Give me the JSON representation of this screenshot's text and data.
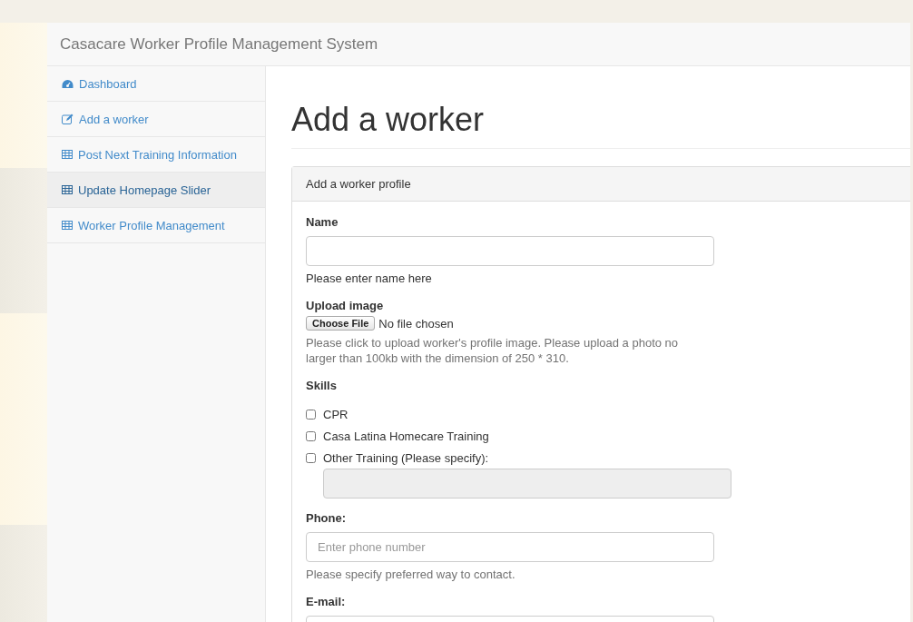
{
  "navbar": {
    "brand": "Casacare Worker Profile Management System"
  },
  "sidebar": {
    "items": [
      {
        "label": "Dashboard",
        "kind": "dashboard",
        "selected": false
      },
      {
        "label": "Add a worker",
        "kind": "edit",
        "selected": false
      },
      {
        "label": "Post Next Training Information",
        "kind": "table",
        "selected": false
      },
      {
        "label": "Update Homepage Slider",
        "kind": "table",
        "selected": true
      },
      {
        "label": "Worker Profile Management",
        "kind": "table",
        "selected": false
      }
    ]
  },
  "page_title": "Add a worker",
  "panel": {
    "heading": "Add a worker profile",
    "fields": [
      {
        "kind": "text",
        "label": "Name",
        "help": "Please enter name here",
        "help_dark": true
      },
      {
        "kind": "file",
        "label": "Upload image",
        "button": "Choose File",
        "status": "No file chosen",
        "help": "Please click to upload worker's profile image. Please upload a photo no larger than 100kb with the dimension of 250 * 310."
      },
      {
        "kind": "checks",
        "label": "Skills",
        "options": [
          {
            "label": "CPR",
            "checked": false
          },
          {
            "label": "Casa Latina Homecare Training",
            "checked": false
          },
          {
            "label": "Other Training (Please specify):",
            "checked": false
          }
        ],
        "other_disabled": true
      },
      {
        "kind": "text",
        "label": "Phone:",
        "placeholder": "Enter phone number",
        "help": "Please specify preferred way to contact.",
        "help_dark": false
      },
      {
        "kind": "text",
        "label": "E-mail:"
      }
    ]
  }
}
